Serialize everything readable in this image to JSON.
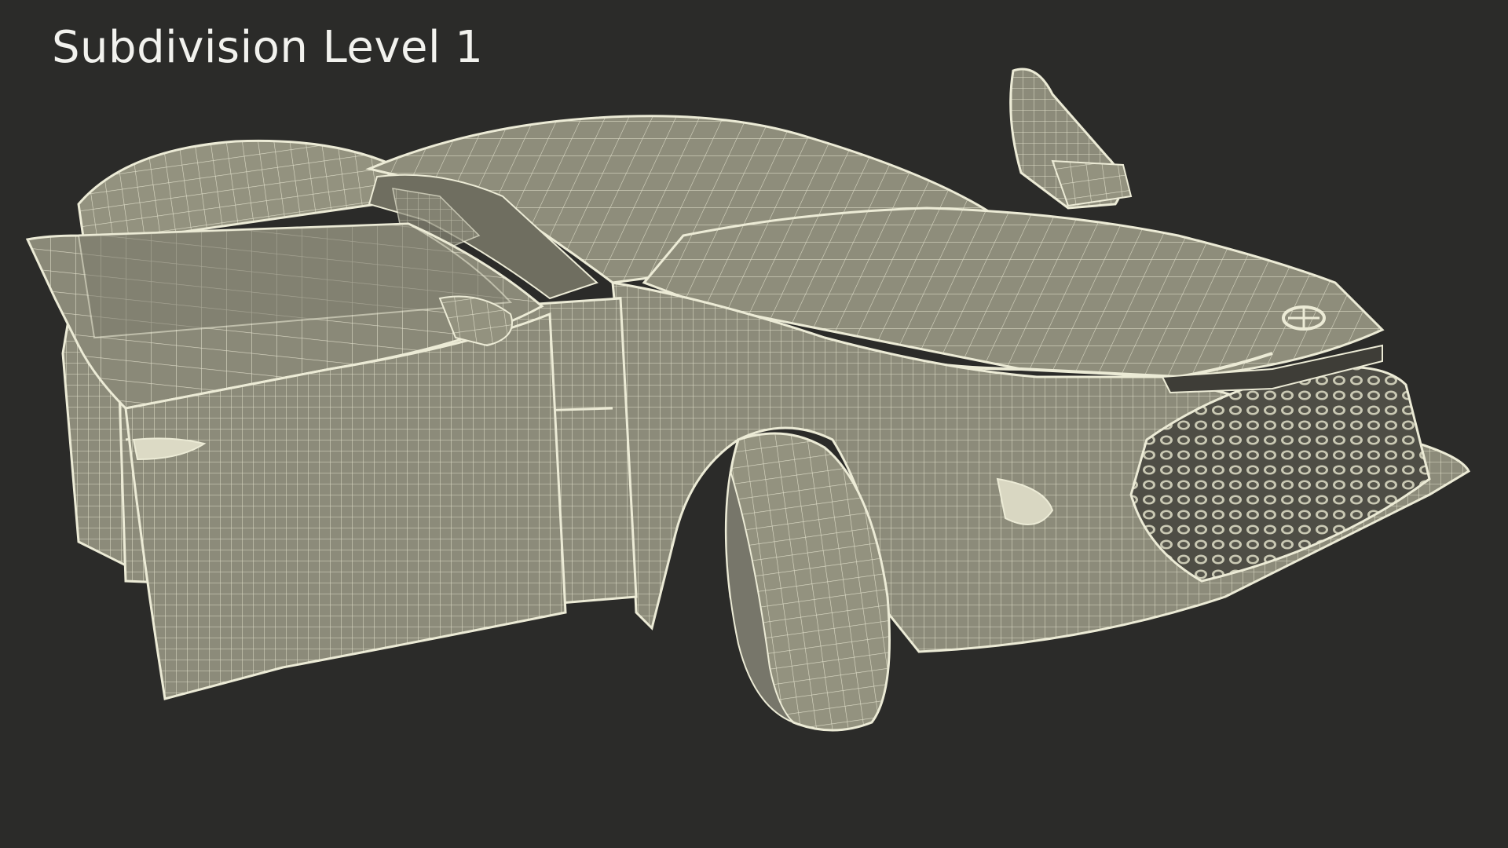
{
  "overlay": {
    "title": "Subdivision Level 1"
  },
  "colors": {
    "background": "#2b2b29",
    "surface": "#8f8f7e",
    "wire": "#ecebd6",
    "title_text": "#f2f2ee"
  }
}
